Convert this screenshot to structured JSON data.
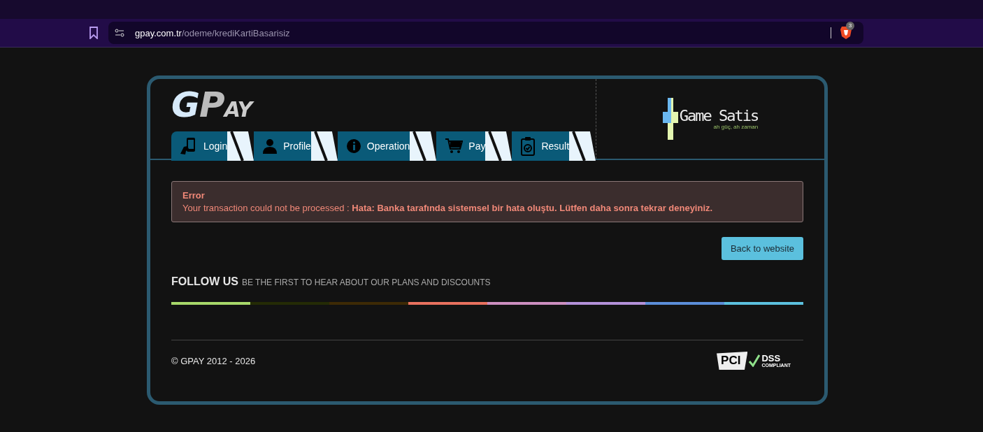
{
  "browser": {
    "url_host": "gpay.com.tr",
    "url_path": "/odeme/krediKartiBasarisiz",
    "shield_badge": "3"
  },
  "logo": {
    "letters": [
      "G",
      "P",
      "AY"
    ]
  },
  "steps": [
    {
      "kind": "phone",
      "label": "Login"
    },
    {
      "kind": "person",
      "label": "Profile"
    },
    {
      "kind": "info",
      "label": "Operation"
    },
    {
      "kind": "cart",
      "label": "Pay"
    },
    {
      "kind": "clipboard",
      "label": "Result"
    }
  ],
  "merchant_logo": {
    "name": "Game Satis",
    "tagline": "ah güç, ah zaman"
  },
  "alert": {
    "title": "Error",
    "message": "Your transaction could not be processed : **Hata: Banka tarafında sistemsel bir hata oluştu. Lütfen daha sonra tekrar deneyiniz.**"
  },
  "back_button": "Back to website",
  "follow": {
    "title": "FOLLOW US",
    "subtitle": "BE THE FIRST TO HEAR ABOUT OUR PLANS AND DISCOUNTS"
  },
  "color_bar": [
    {
      "color": "#a8d86a"
    },
    {
      "color": "#242b05"
    },
    {
      "color": "#3d2a05"
    },
    {
      "color": "#e8715e"
    },
    {
      "color": "#cc8fc0"
    },
    {
      "color": "#b391d9"
    },
    {
      "color": "#5b8ed9"
    },
    {
      "color": "#5bc0de"
    }
  ],
  "footer": {
    "copyright": "© GPAY 2012 - 2026",
    "pci": {
      "mark": "PCI",
      "dss": "DSS",
      "compliant": "COMPLIANT"
    }
  }
}
